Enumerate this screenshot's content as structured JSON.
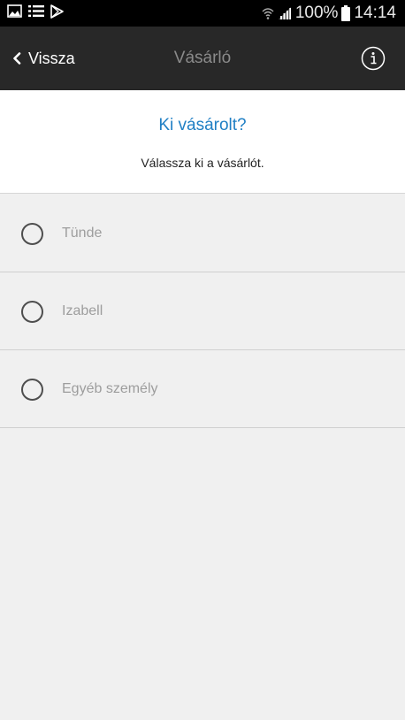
{
  "status_bar": {
    "icons_left": [
      "image-icon",
      "list-icon",
      "play-store-icon"
    ],
    "icons_right": [
      "wifi-icon",
      "signal-icon"
    ],
    "battery": "100%",
    "battery_icon": "battery-icon",
    "time": "14:14"
  },
  "app_bar": {
    "back_label": "Vissza",
    "back_icon": "chevron-left-icon",
    "title": "Vásárló",
    "info_icon": "info-icon"
  },
  "header": {
    "question": "Ki vásárolt?",
    "instruction": "Válassza ki a vásárlót."
  },
  "options": [
    {
      "label": "Tünde",
      "selected": false
    },
    {
      "label": "Izabell",
      "selected": false
    },
    {
      "label": "Egyéb személy",
      "selected": false
    }
  ],
  "colors": {
    "status_bar": "#000000",
    "app_bar": "#282828",
    "accent": "#1f7fc4",
    "background": "#f0f0f0",
    "option_text": "#9d9d9d"
  }
}
